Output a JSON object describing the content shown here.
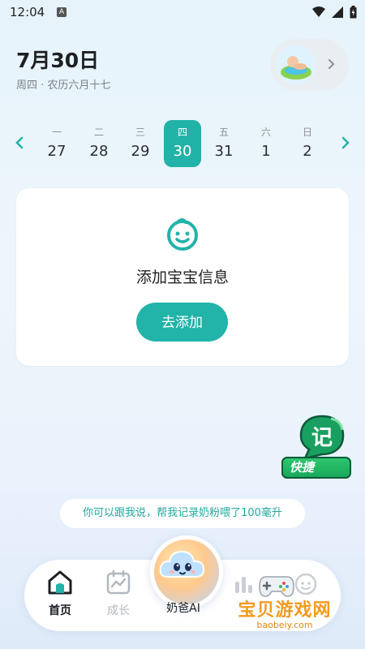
{
  "status_bar": {
    "time": "12:04",
    "notification_icon": "A"
  },
  "header": {
    "date_title": "7月30日",
    "date_subtitle": "周四 · 农历六月十七"
  },
  "week": {
    "days": [
      {
        "weekday": "一",
        "date": "27"
      },
      {
        "weekday": "二",
        "date": "28"
      },
      {
        "weekday": "三",
        "date": "29"
      },
      {
        "weekday": "四",
        "date": "30",
        "selected": true
      },
      {
        "weekday": "五",
        "date": "31"
      },
      {
        "weekday": "六",
        "date": "1"
      },
      {
        "weekday": "日",
        "date": "2"
      }
    ]
  },
  "card": {
    "title": "添加宝宝信息",
    "button_label": "去添加"
  },
  "quick": {
    "label": "快捷",
    "bubble_text": "记"
  },
  "hint": {
    "text": "你可以跟我说，帮我记录奶粉喂了100毫升"
  },
  "tabbar": {
    "home_label": "首页",
    "growth_label": "成长",
    "ai_label": "奶爸AI"
  },
  "watermark": {
    "title": "宝贝游戏网",
    "url": "baobeiy.com"
  },
  "colors": {
    "accent": "#22b3a9",
    "text_primary": "#1c1f23",
    "text_muted": "#7a8087"
  }
}
